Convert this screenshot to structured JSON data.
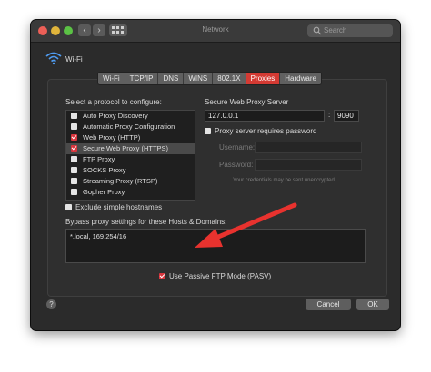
{
  "window": {
    "title": "Network",
    "search_placeholder": "Search"
  },
  "interface": {
    "name": "Wi-Fi"
  },
  "tabs": [
    {
      "label": "Wi-Fi"
    },
    {
      "label": "TCP/IP"
    },
    {
      "label": "DNS"
    },
    {
      "label": "WINS"
    },
    {
      "label": "802.1X"
    },
    {
      "label": "Proxies",
      "active": true
    },
    {
      "label": "Hardware"
    }
  ],
  "protocols": {
    "heading": "Select a protocol to configure:",
    "items": [
      {
        "label": "Auto Proxy Discovery",
        "checked": false
      },
      {
        "label": "Automatic Proxy Configuration",
        "checked": false
      },
      {
        "label": "Web Proxy (HTTP)",
        "checked": true
      },
      {
        "label": "Secure Web Proxy (HTTPS)",
        "checked": true,
        "selected": true
      },
      {
        "label": "FTP Proxy",
        "checked": false
      },
      {
        "label": "SOCKS Proxy",
        "checked": false
      },
      {
        "label": "Streaming Proxy (RTSP)",
        "checked": false
      },
      {
        "label": "Gopher Proxy",
        "checked": false
      }
    ]
  },
  "proxy_server": {
    "heading": "Secure Web Proxy Server",
    "host": "127.0.0.1",
    "separator": ":",
    "port": "9090",
    "requires_password_label": "Proxy server requires password",
    "username_label": "Username:",
    "password_label": "Password:",
    "note": "Your credentials may be sent unencrypted"
  },
  "exclude_simple_label": "Exclude simple hostnames",
  "bypass": {
    "label": "Bypass proxy settings for these Hosts & Domains:",
    "value": "*.local, 169.254/16"
  },
  "passive_ftp_label": "Use Passive FTP Mode (PASV)",
  "buttons": {
    "help": "?",
    "cancel": "Cancel",
    "ok": "OK"
  },
  "colors": {
    "accent": "#d43a33",
    "arrow": "#e8322e"
  }
}
